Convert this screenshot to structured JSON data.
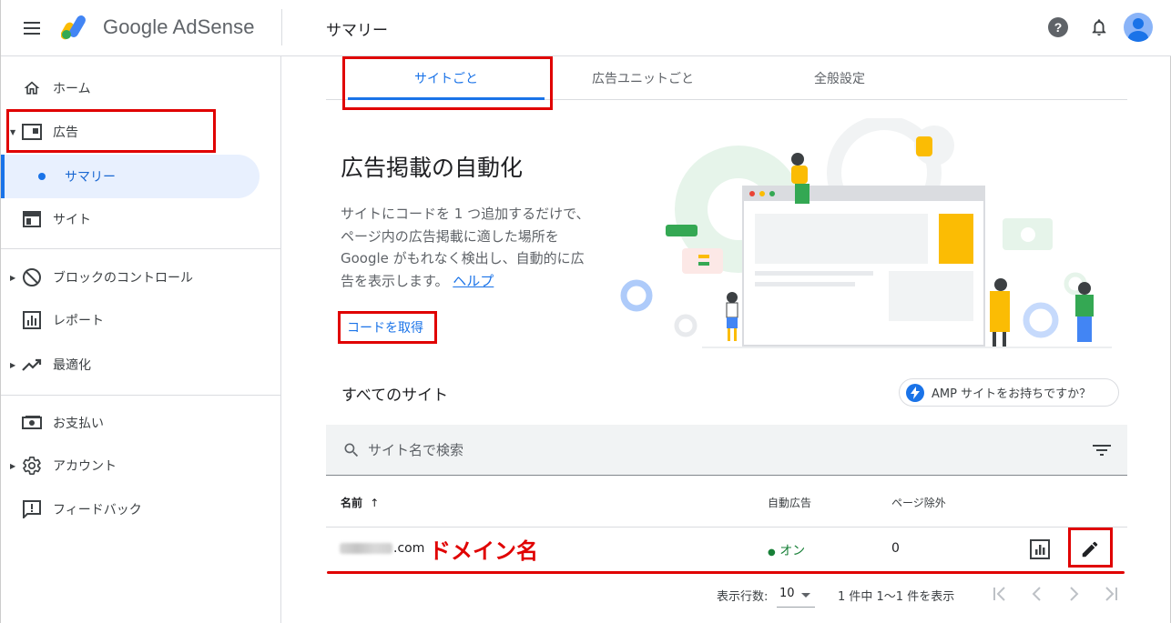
{
  "header": {
    "brand": "Google AdSense",
    "page_title": "サマリー"
  },
  "sidebar": {
    "items": [
      {
        "label": "ホーム",
        "icon": "home-icon"
      },
      {
        "label": "広告",
        "icon": "ads-icon"
      },
      {
        "label": "サマリー"
      },
      {
        "label": "サイト",
        "icon": "sites-icon"
      },
      {
        "label": "ブロックのコントロール",
        "icon": "block-icon"
      },
      {
        "label": "レポート",
        "icon": "reports-icon"
      },
      {
        "label": "最適化",
        "icon": "optimization-icon"
      },
      {
        "label": "お支払い",
        "icon": "payments-icon"
      },
      {
        "label": "アカウント",
        "icon": "settings-gear-icon"
      },
      {
        "label": "フィードバック",
        "icon": "feedback-icon"
      }
    ]
  },
  "tabs": [
    {
      "label": "サイトごと",
      "active": true
    },
    {
      "label": "広告ユニットごと",
      "active": false
    },
    {
      "label": "全般設定",
      "active": false
    }
  ],
  "hero": {
    "title": "広告掲載の自動化",
    "desc_line1": "サイトにコードを 1 つ追加するだけで、",
    "desc_line2": "ページ内の広告掲載に適した場所を",
    "desc_line3": "Google がもれなく検出し、自動的に広",
    "desc_line4": "告を表示します。",
    "help_link": "ヘルプ",
    "get_code": "コードを取得"
  },
  "sites": {
    "heading": "すべてのサイト",
    "amp_chip": "AMP サイトをお持ちですか？",
    "search_placeholder": "サイト名で検索",
    "columns": {
      "name": "名前",
      "auto_ads": "自動広告",
      "page_exclusion": "ページ除外"
    },
    "rows": [
      {
        "name_suffix": ".com",
        "auto_ads": "オン",
        "page_exclusion": "0"
      }
    ],
    "annotation": "ドメイン名"
  },
  "pagination": {
    "rows_label": "表示行数:",
    "rows_value": "10",
    "range": "1 件中 1〜1 件を表示"
  },
  "colors": {
    "accent": "#1a73e8",
    "annotation_red": "#e00000",
    "status_green": "#188038"
  }
}
